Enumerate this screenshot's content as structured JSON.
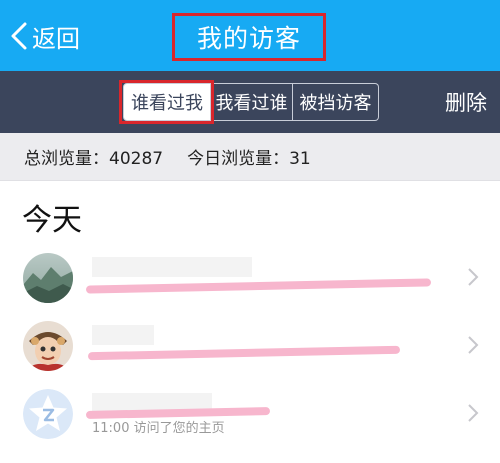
{
  "header": {
    "back_label": "返回",
    "title": "我的访客"
  },
  "toolbar": {
    "tabs": [
      {
        "label": "谁看过我",
        "active": true
      },
      {
        "label": "我看过谁",
        "active": false
      },
      {
        "label": "被挡访客",
        "active": false
      }
    ],
    "delete_label": "删除"
  },
  "stats": {
    "total": "总浏览量：40287",
    "today": "今日浏览量：31"
  },
  "section": {
    "title": "今天"
  },
  "visitors": [
    {
      "detail": "",
      "icon": "landscape-avatar"
    },
    {
      "detail": "",
      "icon": "character-avatar"
    },
    {
      "detail": "11:00 访问了您的主页",
      "icon": "default-avatar"
    }
  ],
  "colors": {
    "header_bg": "#17aaf3",
    "toolbar_bg": "#3b455c",
    "highlight": "#d9262c",
    "redaction": "#f7b6cd"
  }
}
